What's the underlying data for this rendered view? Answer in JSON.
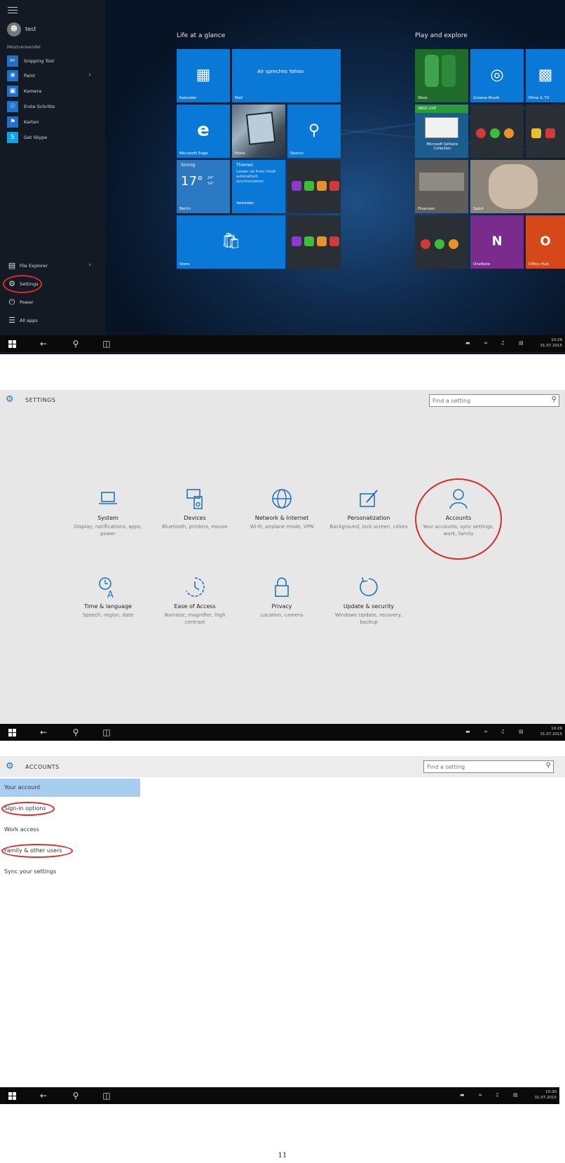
{
  "start_screen": {
    "user_name": "test",
    "most_used_label": "Meistverwendet",
    "apps": [
      {
        "label": "Snipping Tool",
        "icon": "scissors-icon",
        "has_submenu": false
      },
      {
        "label": "Paint",
        "icon": "paint-icon",
        "has_submenu": true
      },
      {
        "label": "Kamera",
        "icon": "camera-icon",
        "has_submenu": false
      },
      {
        "label": "Erste Schritte",
        "icon": "lightbulb-icon",
        "has_submenu": false
      },
      {
        "label": "Karten",
        "icon": "map-icon",
        "has_submenu": false
      },
      {
        "label": "Get Skype",
        "icon": "skype-icon",
        "has_submenu": false
      }
    ],
    "system_items": [
      {
        "label": "File Explorer",
        "icon": "folder-icon",
        "has_submenu": true
      },
      {
        "label": "Settings",
        "icon": "gear-icon",
        "highlighted": true
      },
      {
        "label": "Power",
        "icon": "power-icon"
      },
      {
        "label": "All apps",
        "icon": "list-icon"
      }
    ],
    "life_heading": "Life at a glance",
    "play_heading": "Play and explore",
    "tiles": {
      "kalender": "Kalender",
      "mail": "Mail",
      "mail_text": "Air spreches Yahoo",
      "edge": "Microsoft Edge",
      "fotos": "Fotos",
      "search": "Search",
      "weather_condition": "Sonnig",
      "weather_temp": "17°",
      "weather_high": "24°",
      "weather_low": "14°",
      "weather_city": "Berlin",
      "news_title": "Themen",
      "news_body": "Lassen sie Ihren Inhalt automatisch synchronisieren",
      "news_footer": "Verbinden",
      "store": "Store",
      "xbox": "Xbox",
      "xbox_live": "XBOX LIVE",
      "groove": "Groove-Musik",
      "films": "Filme & TV",
      "solitaire": "Microsoft Solitaire Collection",
      "finance": "Finanzen",
      "sports": "Sport",
      "onenote": "OneNote",
      "office": "Office Hub"
    },
    "taskbar": {
      "time": "10:29",
      "date": "31.07.2015"
    }
  },
  "settings_screen": {
    "title": "SETTINGS",
    "search_placeholder": "Find a setting",
    "categories": [
      {
        "title": "System",
        "desc": "Display, notifications, apps, power",
        "icon": "laptop-icon"
      },
      {
        "title": "Devices",
        "desc": "Bluetooth, printers, mouse",
        "icon": "devices-icon"
      },
      {
        "title": "Network & Internet",
        "desc": "Wi-Fi, airplane mode, VPN",
        "icon": "globe-icon"
      },
      {
        "title": "Personalization",
        "desc": "Background, lock screen, colors",
        "icon": "paintbrush-icon"
      },
      {
        "title": "Accounts",
        "desc": "Your accounts, sync settings, work, family",
        "icon": "person-icon",
        "highlighted": true
      },
      {
        "title": "Time & language",
        "desc": "Speech, region, date",
        "icon": "clock-language-icon"
      },
      {
        "title": "Ease of Access",
        "desc": "Narrator, magnifier, high contrast",
        "icon": "ease-of-access-icon"
      },
      {
        "title": "Privacy",
        "desc": "Location, camera",
        "icon": "lock-icon"
      },
      {
        "title": "Update & security",
        "desc": "Windows Update, recovery, backup",
        "icon": "refresh-icon"
      }
    ],
    "taskbar": {
      "time": "10:29",
      "date": "31.07.2015"
    }
  },
  "accounts_screen": {
    "title": "ACCOUNTS",
    "search_placeholder": "Find a setting",
    "nav": [
      {
        "label": "Your account",
        "active": true,
        "highlighted": false
      },
      {
        "label": "Sign-in options",
        "active": false,
        "highlighted": true
      },
      {
        "label": "Work access",
        "active": false,
        "highlighted": false
      },
      {
        "label": "Family & other users",
        "active": false,
        "highlighted": true
      },
      {
        "label": "Sync your settings",
        "active": false,
        "highlighted": false
      }
    ],
    "taskbar": {
      "time": "10:30",
      "date": "31.07.2015"
    }
  },
  "page_number": "11",
  "colors": {
    "accent": "#0a78d7",
    "highlight_ring": "#d92b2b",
    "settings_bg": "#e7e7e7"
  }
}
